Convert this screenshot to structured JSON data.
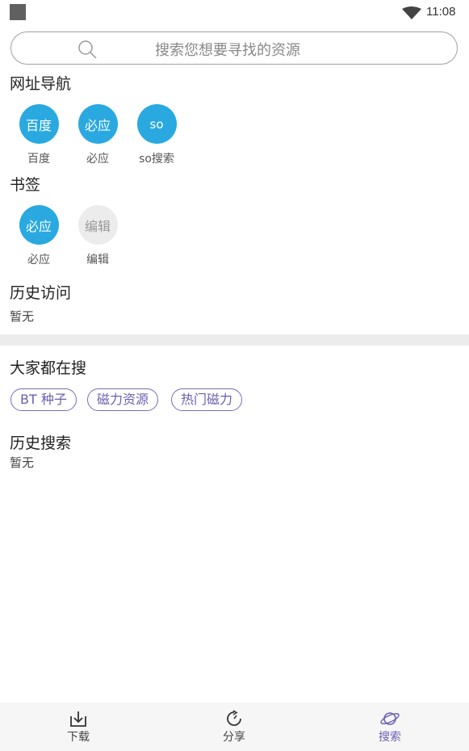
{
  "status_bar": {
    "time": "11:08"
  },
  "search": {
    "placeholder": "搜索您想要寻找的资源"
  },
  "nav_section": {
    "title": "网址导航",
    "items": [
      {
        "icon_text": "百度",
        "label": "百度"
      },
      {
        "icon_text": "必应",
        "label": "必应"
      },
      {
        "icon_text": "so",
        "label": "so搜索"
      }
    ]
  },
  "bookmarks": {
    "title": "书签",
    "items": [
      {
        "icon_text": "必应",
        "label": "必应"
      },
      {
        "icon_text": "编辑",
        "label": "编辑"
      }
    ]
  },
  "history_visits": {
    "title": "历史访问",
    "empty_text": "暂无"
  },
  "trending": {
    "title": "大家都在搜",
    "tags": [
      "BT 种子",
      "磁力资源",
      "热门磁力"
    ]
  },
  "history_search": {
    "title": "历史搜索",
    "empty_text": "暂无"
  },
  "tabbar": {
    "tabs": [
      {
        "label": "下载",
        "icon": "download-icon"
      },
      {
        "label": "分享",
        "icon": "share-icon"
      },
      {
        "label": "搜索",
        "icon": "planet-icon",
        "active": true
      }
    ]
  },
  "colors": {
    "accent_blue": "#2aa9e0",
    "tag_purple": "#6b5fb0",
    "divider_gray": "#ececec"
  }
}
